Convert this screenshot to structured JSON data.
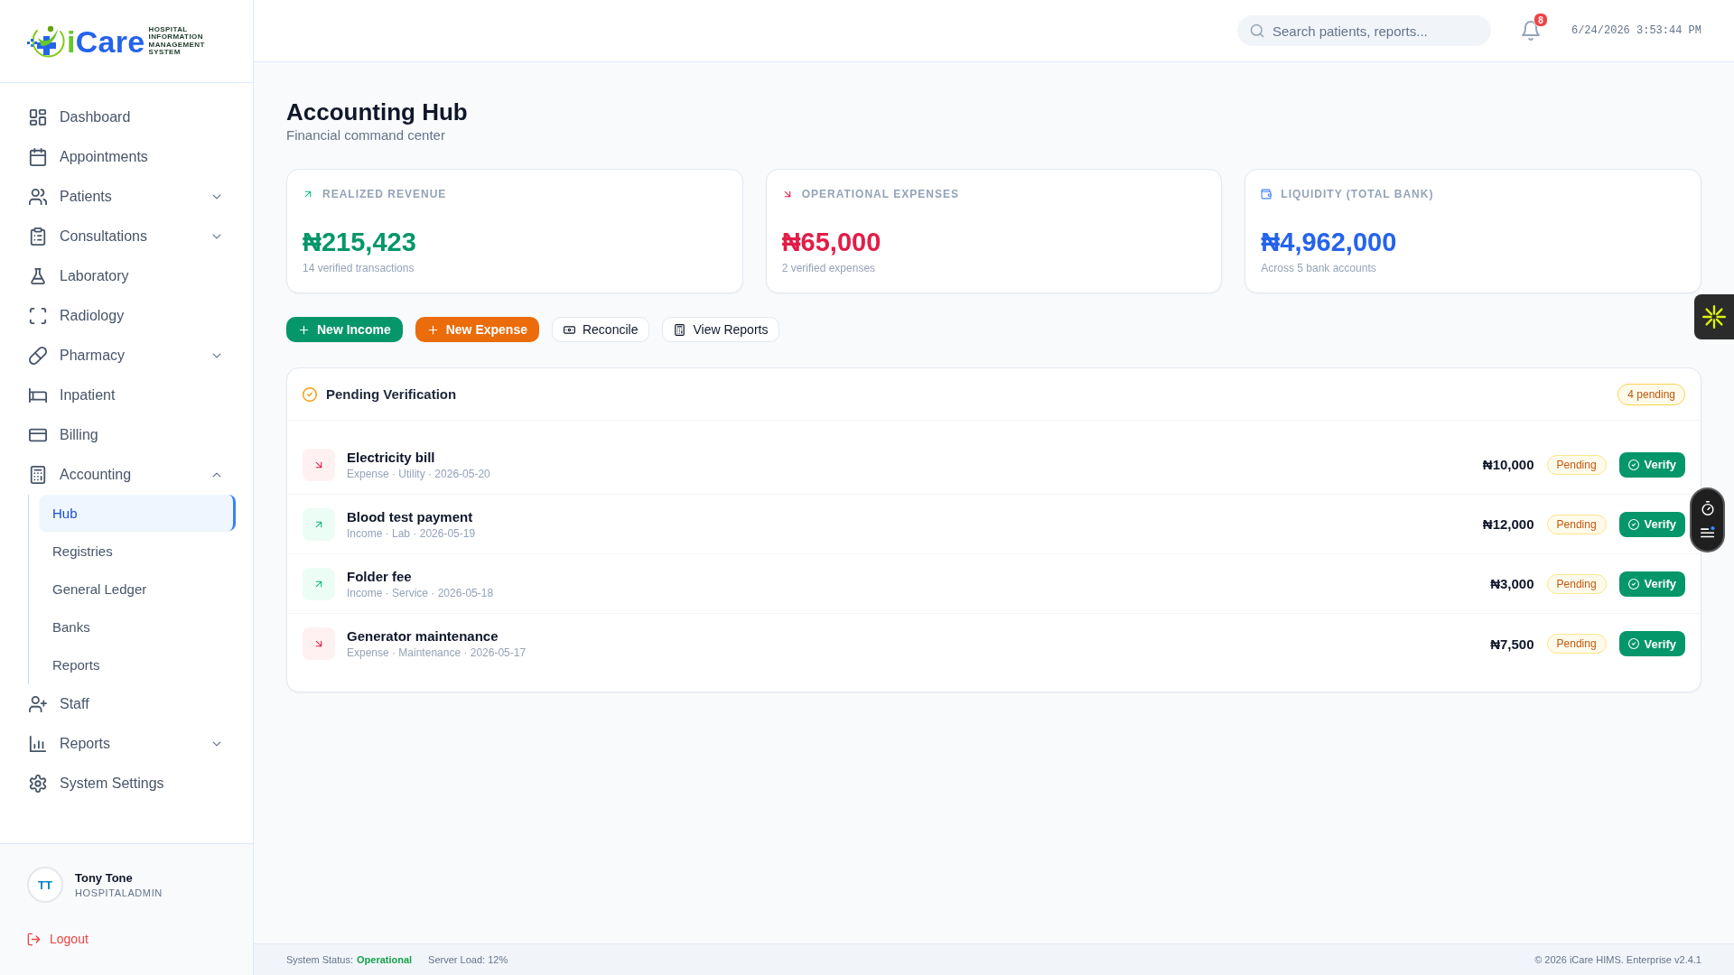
{
  "sidebar": {
    "logo": {
      "name": "iCare",
      "tagline": "HOSPITAL INFORMATION MANAGEMENT SYSTEM"
    },
    "items": [
      {
        "label": "Dashboard",
        "kind": "link",
        "selected": false
      },
      {
        "label": "Appointments",
        "kind": "link",
        "selected": false
      },
      {
        "label": "Patients",
        "kind": "group",
        "expanded": false,
        "selected": false
      },
      {
        "label": "Consultations",
        "kind": "group",
        "expanded": false,
        "selected": false
      },
      {
        "label": "Laboratory",
        "kind": "link",
        "selected": false
      },
      {
        "label": "Radiology",
        "kind": "link",
        "selected": false
      },
      {
        "label": "Pharmacy",
        "kind": "group",
        "expanded": false,
        "selected": false
      },
      {
        "label": "Inpatient",
        "kind": "link",
        "selected": false
      },
      {
        "label": "Billing",
        "kind": "link",
        "selected": false
      },
      {
        "label": "Accounting",
        "kind": "group",
        "expanded": true,
        "selected": false,
        "children": [
          {
            "label": "Hub",
            "selected": true
          },
          {
            "label": "Registries",
            "selected": false
          },
          {
            "label": "General Ledger",
            "selected": false
          },
          {
            "label": "Banks",
            "selected": false
          },
          {
            "label": "Reports",
            "selected": false
          }
        ]
      },
      {
        "label": "Staff",
        "kind": "link",
        "selected": false
      },
      {
        "label": "Reports",
        "kind": "group",
        "expanded": false,
        "selected": false
      },
      {
        "label": "System Settings",
        "kind": "link",
        "selected": false
      }
    ],
    "user": {
      "initials": "TT",
      "name": "Tony Tone",
      "role": "HOSPITALADMIN"
    },
    "logout": {
      "label": "Logout"
    }
  },
  "header": {
    "search": {
      "placeholder": "Search patients, reports..."
    },
    "notification_count": "8",
    "datetime": "6/24/2026 3:53:44 PM"
  },
  "page": {
    "title": "Accounting Hub",
    "subtitle": "Financial command center"
  },
  "stats": [
    {
      "kind": "income",
      "label": "REALIZED REVENUE",
      "value": "₦215,423",
      "note": "14 verified transactions"
    },
    {
      "kind": "expense",
      "label": "OPERATIONAL EXPENSES",
      "value": "₦65,000",
      "note": "2 verified expenses"
    },
    {
      "kind": "bank",
      "label": "LIQUIDITY (TOTAL BANK)",
      "value": "₦4,962,000",
      "note": "Across 5 bank accounts"
    }
  ],
  "actions": [
    {
      "kind": "income",
      "label": "New Income"
    },
    {
      "kind": "expense",
      "label": "New Expense"
    },
    {
      "kind": "reconcile",
      "label": "Reconcile"
    },
    {
      "kind": "reports",
      "label": "View Reports"
    }
  ],
  "pending": {
    "title": "Pending Verification",
    "badge": "4 pending",
    "rows": [
      {
        "kind": "expense",
        "title": "Electricity bill",
        "meta": "Expense · Utility · 2026-05-20",
        "amount": "₦10,000",
        "status": "Pending",
        "action": "Verify"
      },
      {
        "kind": "income",
        "title": "Blood test payment",
        "meta": "Income · Lab · 2026-05-19",
        "amount": "₦12,000",
        "status": "Pending",
        "action": "Verify"
      },
      {
        "kind": "income",
        "title": "Folder fee",
        "meta": "Income · Service · 2026-05-18",
        "amount": "₦3,000",
        "status": "Pending",
        "action": "Verify"
      },
      {
        "kind": "expense",
        "title": "Generator maintenance",
        "meta": "Expense · Maintenance · 2026-05-17",
        "amount": "₦7,500",
        "status": "Pending",
        "action": "Verify"
      }
    ]
  },
  "status_bar": {
    "status": {
      "label": "System Status:",
      "value": "Operational"
    },
    "server_load": "Server Load: 12%",
    "copyright": "© 2026 iCare HIMS. Enterprise v2.4.1"
  }
}
